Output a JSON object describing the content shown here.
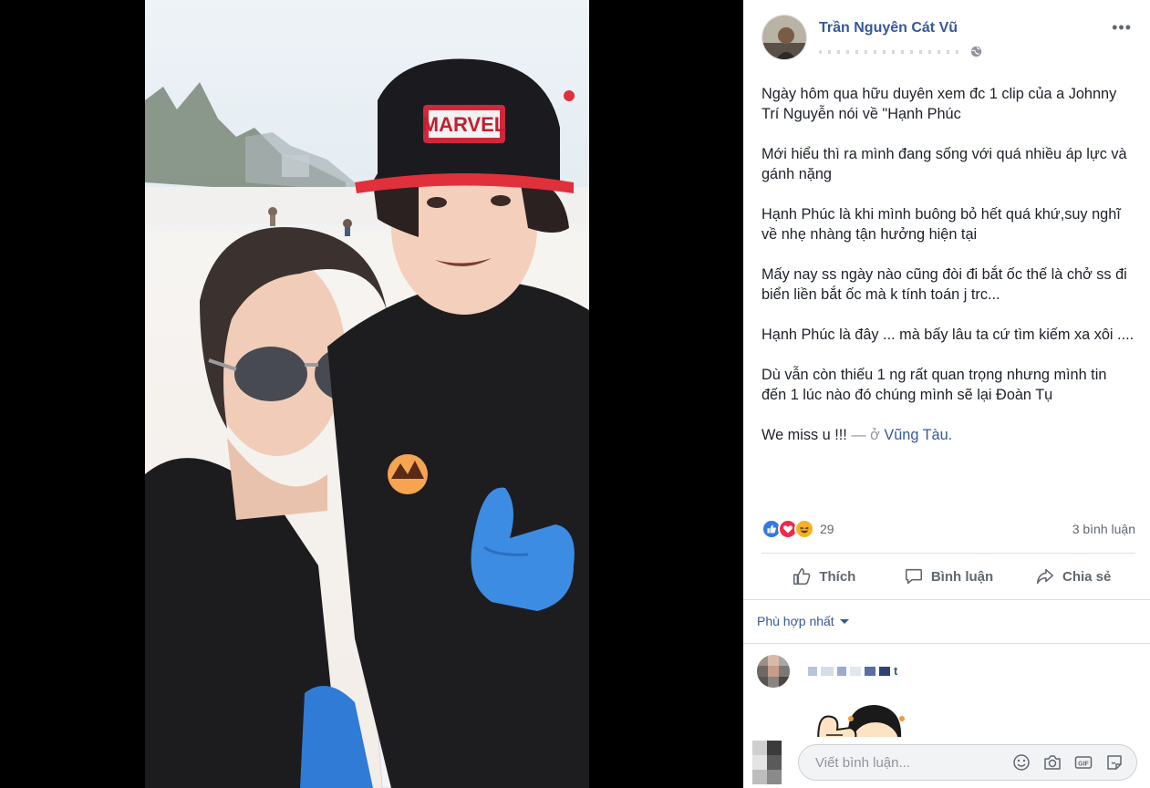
{
  "post": {
    "author": "Trần Nguyên Cát Vũ",
    "paragraphs": [
      "Ngày hôm qua hữu duyên xem đc 1 clip của a Johnny Trí Nguyễn nói về \"Hạnh Phúc",
      "Mới hiểu thì ra mình đang sống với quá nhiều áp lực và gánh nặng",
      "Hạnh Phúc là khi mình buông bỏ hết quá khứ,suy nghĩ về nhẹ nhàng tận hưởng hiện tại",
      "Mấy nay ss ngày nào cũng đòi đi bắt ốc thế là chở ss đi biển liền bắt ốc mà k tính toán j trc...",
      "Hạnh Phúc là đây ... mà bấy lâu ta cứ tìm kiếm xa xôi ....",
      "Dù vẫn còn thiếu 1 ng rất quan trọng nhưng mình tin đến 1 lúc nào đó chúng mình sẽ lại Đoàn Tụ"
    ],
    "last_line": "We miss u !!!",
    "location_sep": "— ở",
    "location": "Vũng Tàu",
    "location_end": "."
  },
  "stats": {
    "reactions_count": "29",
    "comments_count": "3 bình luận"
  },
  "actions": {
    "like": "Thích",
    "comment": "Bình luận",
    "share": "Chia sẻ"
  },
  "sort": {
    "label": "Phù hợp nhất"
  },
  "comment": {
    "name_suffix": "t"
  },
  "composer": {
    "placeholder": "Viết bình luận..."
  },
  "colors": {
    "link": "#365899",
    "text": "#1d2129",
    "muted": "#606770"
  },
  "icons": [
    "more-icon",
    "globe-icon",
    "like-reaction-icon",
    "love-reaction-icon",
    "haha-reaction-icon",
    "thumb-icon",
    "comment-icon",
    "share-icon",
    "caret-icon",
    "emoji-icon",
    "camera-icon",
    "gif-icon",
    "sticker-icon"
  ]
}
